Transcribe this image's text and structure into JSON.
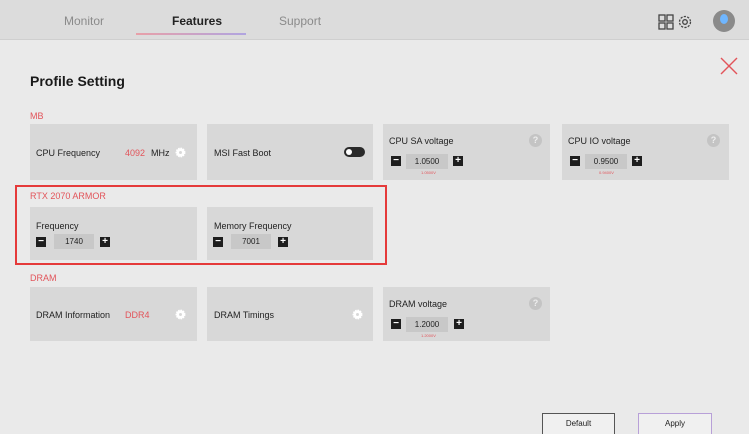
{
  "tabs": [
    {
      "label": "Monitor",
      "active": false
    },
    {
      "label": "Features",
      "active": true
    },
    {
      "label": "Support",
      "active": false
    }
  ],
  "header_icons": [
    "grid-icon",
    "gear-icon",
    "avatar"
  ],
  "page": {
    "title": "Profile Setting",
    "close_icon": "close-icon"
  },
  "sections": {
    "mb": "MB",
    "gpu": "RTX 2070 ARMOR",
    "dram": "DRAM"
  },
  "mb": {
    "cpu_frequency": {
      "label": "CPU Frequency",
      "value": "4092",
      "unit": "MHz"
    },
    "fast_boot": {
      "label": "MSI Fast Boot",
      "on": true
    },
    "cpu_sa": {
      "label": "CPU SA voltage",
      "value": "1.0500",
      "hint": "1.0500V"
    },
    "cpu_io": {
      "label": "CPU IO voltage",
      "value": "0.9500",
      "hint": "0.9400V"
    }
  },
  "gpu": {
    "frequency": {
      "label": "Frequency",
      "value": "1740"
    },
    "memory_frequency": {
      "label": "Memory Frequency",
      "value": "7001"
    }
  },
  "dram": {
    "info": {
      "label": "DRAM Information",
      "value": "DDR4"
    },
    "timings": {
      "label": "DRAM Timings"
    },
    "voltage": {
      "label": "DRAM voltage",
      "value": "1.2000",
      "hint": "1.2000V"
    }
  },
  "buttons": {
    "default": "Default",
    "apply": "Apply"
  },
  "stepper": {
    "minus": "−",
    "plus": "+"
  },
  "colors": {
    "accent": "#e2545a",
    "highlight_box": "#e53a3a",
    "card": "#d8d8d8"
  }
}
